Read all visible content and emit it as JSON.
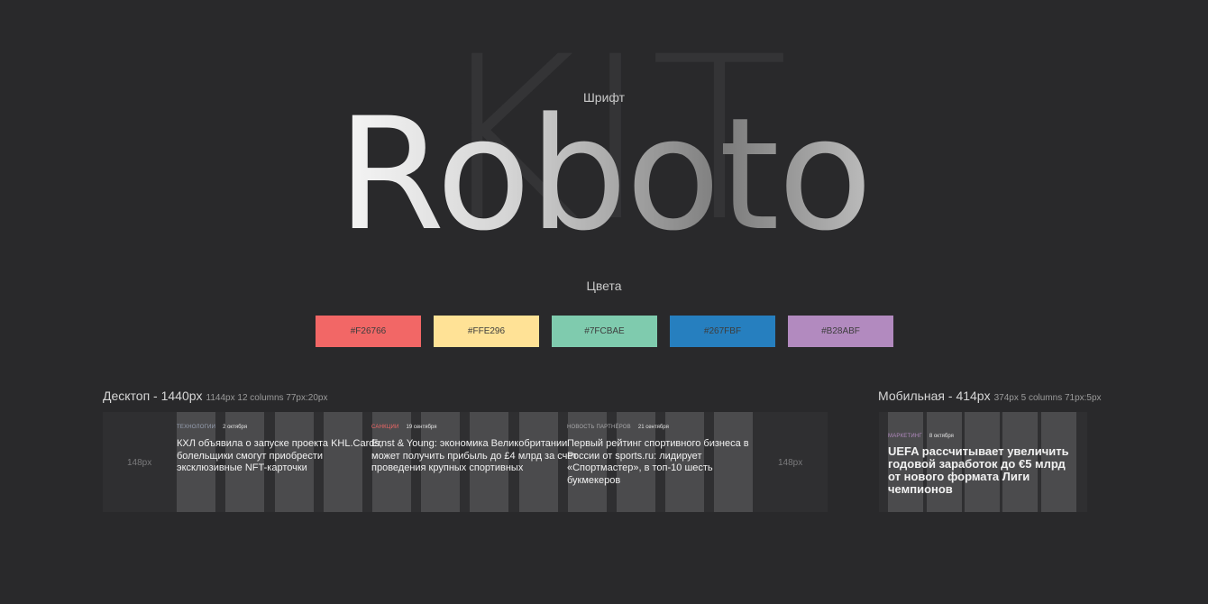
{
  "kit": {
    "word": "KIT"
  },
  "typeface": {
    "caption": "Шрифт",
    "name": "Roboto"
  },
  "palette": {
    "caption": "Цвета",
    "swatches": [
      {
        "label": "#F26766",
        "color": "#F26766"
      },
      {
        "label": "#FFE296",
        "color": "#FFE296"
      },
      {
        "label": "#7FCBAE",
        "color": "#7FCBAE"
      },
      {
        "label": "#267FBF",
        "color": "#267FBF"
      },
      {
        "label": "#B28ABF",
        "color": "#B28ABF"
      }
    ]
  },
  "desktop": {
    "title": "Десктоп - 1440px",
    "meta": "1144px 12 columns 77px:20px",
    "margin_label": "148px",
    "cards": [
      {
        "category": "ТЕХНОЛОГИИ",
        "category_color": "#9aa3b5",
        "date": "2 октября",
        "title": "КХЛ объявила о запуске проекта KHL.Cards, болельщики смогут приобрести эксклюзивные NFT-карточки"
      },
      {
        "category": "САНКЦИИ",
        "category_color": "#F26766",
        "date": "19 сентября",
        "title": "Ernst & Young: экономика Великобритании может получить прибыль до £4 млрд за счёт проведения крупных спортивных"
      },
      {
        "category": "НОВОСТЬ ПАРТНЁРОВ",
        "category_color": "#a9a9ab",
        "date": "21 сентября",
        "title": "Первый рейтинг спортивного бизнеса в России от sports.ru: лидирует «Спортмастер», в топ-10 шесть букмекеров"
      }
    ]
  },
  "mobile": {
    "title": "Мобильная - 414px",
    "meta": "374px 5 columns 71px:5px",
    "card": {
      "category": "МАРКЕТИНГ",
      "category_color": "#B28ABF",
      "date": "8 октября",
      "title": "UEFA рассчитывает увеличить годовой заработок до €5 млрд от нового формата Лиги чемпионов"
    }
  }
}
